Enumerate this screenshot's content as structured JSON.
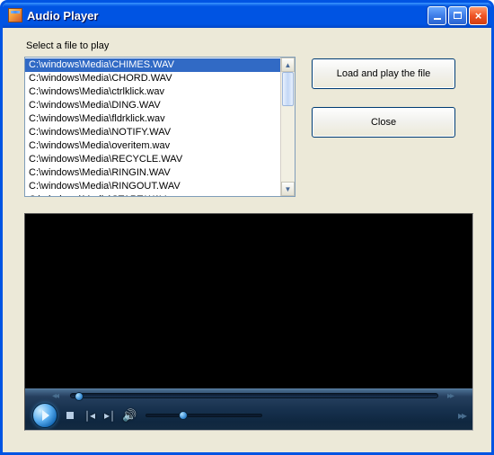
{
  "window": {
    "title": "Audio Player"
  },
  "prompt": "Select a file to play",
  "files": [
    "C:\\windows\\Media\\CHIMES.WAV",
    "C:\\windows\\Media\\CHORD.WAV",
    "C:\\windows\\Media\\ctrlklick.wav",
    "C:\\windows\\Media\\DING.WAV",
    "C:\\windows\\Media\\fldrklick.wav",
    "C:\\windows\\Media\\NOTIFY.WAV",
    "C:\\windows\\Media\\overitem.wav",
    "C:\\windows\\Media\\RECYCLE.WAV",
    "C:\\windows\\Media\\RINGIN.WAV",
    "C:\\windows\\Media\\RINGOUT.WAV",
    "C:\\windows\\Media\\START.WAV"
  ],
  "selected_index": 0,
  "buttons": {
    "load": "Load and play the file",
    "close": "Close"
  }
}
